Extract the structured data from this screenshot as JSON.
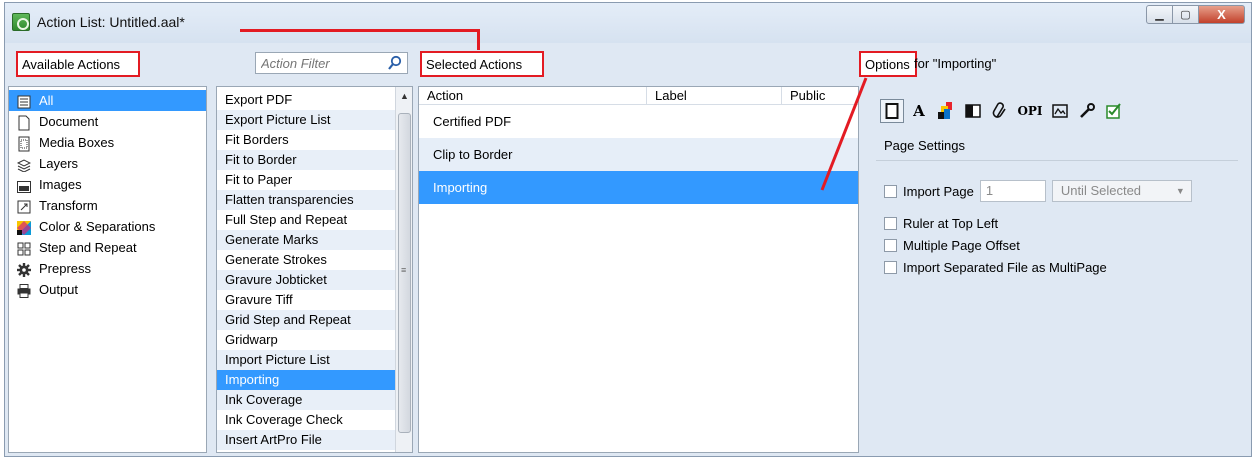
{
  "window": {
    "title": "Action List: Untitled.aal*",
    "min_symbol": "▁",
    "max_symbol": "▢",
    "close_symbol": "X"
  },
  "available": {
    "label": "Available Actions",
    "filter_placeholder": "Action Filter",
    "categories": [
      {
        "label": "All",
        "icon": "all-icon",
        "selected": true
      },
      {
        "label": "Document",
        "icon": "document-icon"
      },
      {
        "label": "Media Boxes",
        "icon": "media-boxes-icon"
      },
      {
        "label": "Layers",
        "icon": "layers-icon"
      },
      {
        "label": "Images",
        "icon": "images-icon"
      },
      {
        "label": "Transform",
        "icon": "transform-icon"
      },
      {
        "label": "Color & Separations",
        "icon": "color-separations-icon"
      },
      {
        "label": "Step and Repeat",
        "icon": "step-repeat-icon"
      },
      {
        "label": "Prepress",
        "icon": "gear-icon"
      },
      {
        "label": "Output",
        "icon": "printer-icon"
      }
    ],
    "actions": [
      "Export PDF",
      "Export Picture List",
      "Fit Borders",
      "Fit to Border",
      "Fit to Paper",
      "Flatten transparencies",
      "Full Step and Repeat",
      "Generate Marks",
      "Generate Strokes",
      "Gravure Jobticket",
      "Gravure Tiff",
      "Grid Step and Repeat",
      "Gridwarp",
      "Import Picture List",
      "Importing",
      "Ink Coverage",
      "Ink Coverage Check",
      "Insert ArtPro File"
    ],
    "selected_action": "Importing"
  },
  "selected": {
    "label": "Selected Actions",
    "columns": [
      "Action",
      "Label",
      "Public"
    ],
    "rows": [
      "Certified PDF",
      "Clip to Border",
      "Importing"
    ],
    "selected_row": "Importing"
  },
  "options": {
    "label": "Options",
    "for_text": "for \"Importing\"",
    "section": "Page Settings",
    "toolbar_letters": {
      "a": "A",
      "opi": "OPI"
    },
    "import_page_label": "Import Page",
    "import_page_value": "1",
    "until_label": "Until Selected",
    "checkboxes": [
      "Ruler at Top Left",
      "Multiple Page Offset",
      "Import Separated File as MultiPage"
    ]
  },
  "colors": {
    "highlight": "#3399ff",
    "annotation_red": "#e31b23"
  }
}
